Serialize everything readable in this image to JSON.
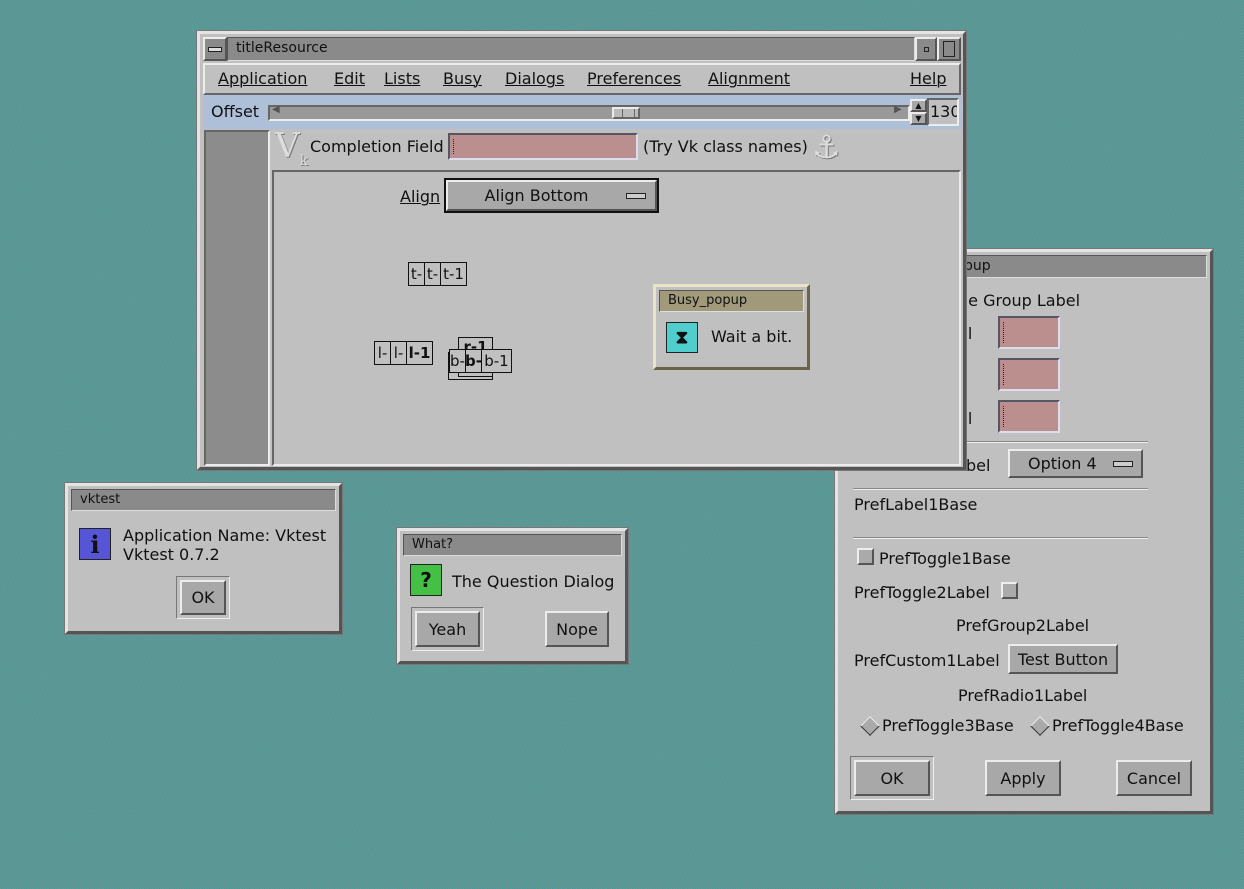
{
  "main": {
    "title": "titleResource",
    "menu": [
      "Application",
      "Edit",
      "Lists",
      "Busy",
      "Dialogs",
      "Preferences",
      "Alignment",
      "Help"
    ],
    "offset_label": "Offset",
    "offset_value": "130",
    "completion_label": "Completion Field",
    "completion_value": "",
    "completion_hint": "(Try Vk class names)",
    "align_label": "Align",
    "align_value": "Align Bottom",
    "top_boxes": [
      "t-",
      "t-",
      "t-1"
    ],
    "left_boxes": [
      "l-",
      "l-",
      "l-1"
    ],
    "right_box": "r-1",
    "bottom_boxes": [
      "b-",
      "b-",
      "b-1"
    ],
    "busy": {
      "title": "Busy_popup",
      "message": "Wait a bit."
    }
  },
  "prefs": {
    "title_visible": "pup",
    "group_label_visible": "he Group Label",
    "row1_label_visible": "el",
    "row3_label_visible": "el",
    "option_label_visible": "bel",
    "option_value": "Option 4",
    "label1": "PrefLabel1Base",
    "toggle1": "PrefToggle1Base",
    "toggle2": "PrefToggle2Label",
    "group2": "PrefGroup2Label",
    "custom1": "PrefCustom1Label",
    "test_button": "Test Button",
    "radio1": "PrefRadio1Label",
    "toggle3": "PrefToggle3Base",
    "toggle4": "PrefToggle4Base",
    "ok": "OK",
    "apply": "Apply",
    "cancel": "Cancel"
  },
  "about": {
    "title": "vktest",
    "line1": "Application Name: Vktest",
    "line2": "Vktest 0.7.2",
    "ok": "OK"
  },
  "question": {
    "title": "What?",
    "message": "The Question Dialog",
    "yes": "Yeah",
    "no": "Nope"
  },
  "colors": {
    "field": "#bc8f8f",
    "offset_bar": "#adc0d8",
    "busy_title": "#a09a7a",
    "info_icon": "#5555d5",
    "question_icon": "#44c044",
    "hourglass_icon": "#50cece"
  }
}
